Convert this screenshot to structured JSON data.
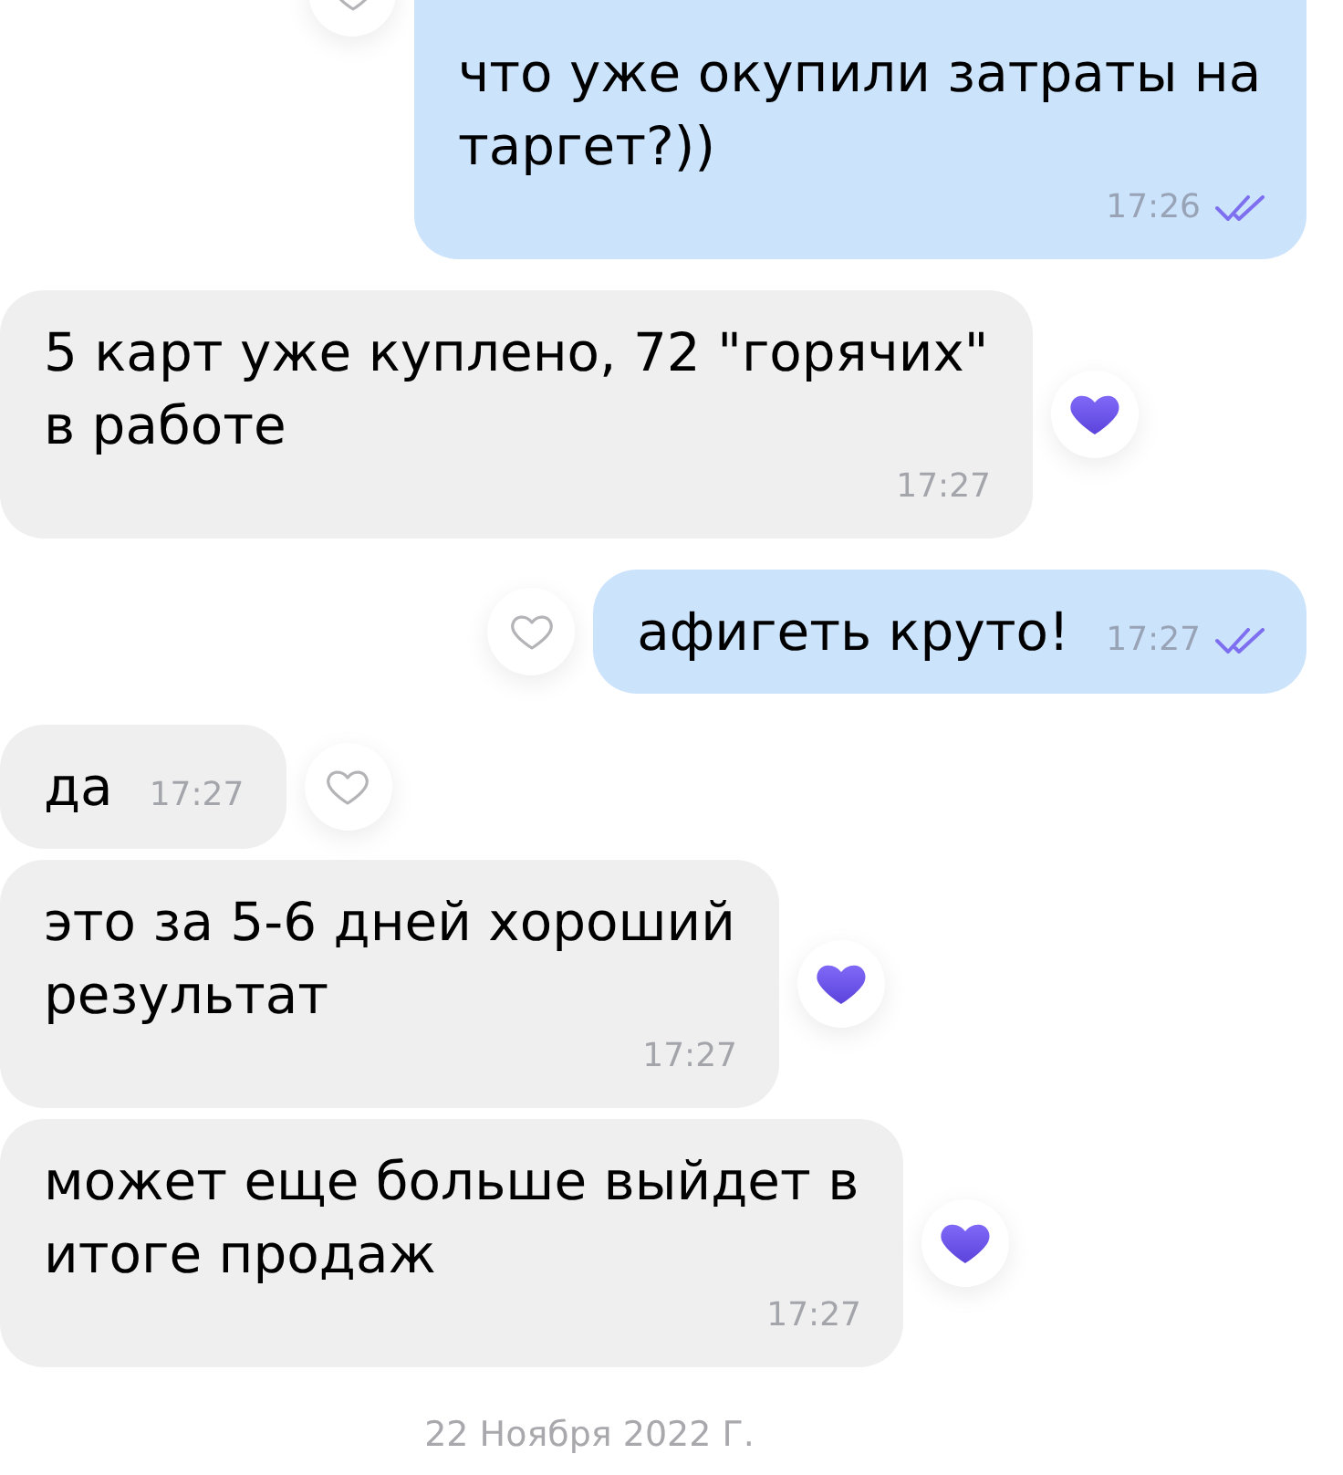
{
  "messages": [
    {
      "kind": "outgoing",
      "text": "что уже окупили затраты на таргет?))",
      "time": "17:26",
      "read": true,
      "liked": false
    },
    {
      "kind": "incoming",
      "text": "5 карт уже куплено, 72 \"горячих\" в работе",
      "time": "17:27",
      "liked": true
    },
    {
      "kind": "outgoing",
      "text": "афигеть круто!",
      "time": "17:27",
      "read": true,
      "liked": false
    },
    {
      "kind": "incoming",
      "text": "да",
      "time": "17:27",
      "liked": false
    },
    {
      "kind": "incoming",
      "text": "это за 5-6 дней хороший результат",
      "time": "17:27",
      "liked": true
    },
    {
      "kind": "incoming",
      "text": "может еще больше выйдет в итоге продаж",
      "time": "17:27",
      "liked": true
    }
  ],
  "date_separator": "22 Ноября 2022 Г."
}
